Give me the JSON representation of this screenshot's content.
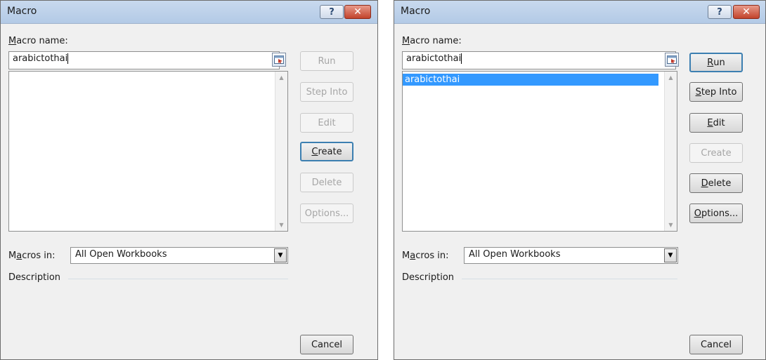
{
  "dialogs": [
    {
      "title": "Macro",
      "help_glyph": "?",
      "close_glyph": "✕",
      "macro_name_label": {
        "prefix": "",
        "accel": "M",
        "suffix": "acro name:"
      },
      "macro_name_value": "arabictothai",
      "macro_list": [],
      "buttons": {
        "run": {
          "prefix": "",
          "accel": "",
          "suffix": "Run",
          "enabled": false
        },
        "step_into": {
          "prefix": "",
          "accel": "",
          "suffix": "Step Into",
          "enabled": false
        },
        "edit": {
          "prefix": "",
          "accel": "",
          "suffix": "Edit",
          "enabled": false
        },
        "create": {
          "prefix": "",
          "accel": "C",
          "suffix": "reate",
          "enabled": true
        },
        "delete": {
          "prefix": "",
          "accel": "",
          "suffix": "Delete",
          "enabled": false
        },
        "options": {
          "prefix": "",
          "accel": "",
          "suffix": "Options...",
          "enabled": false
        },
        "cancel": {
          "prefix": "",
          "accel": "",
          "suffix": "Cancel",
          "enabled": true
        }
      },
      "macros_in_label": {
        "prefix": "M",
        "accel": "a",
        "suffix": "cros in:"
      },
      "macros_in_value": "All Open Workbooks",
      "description_label": "Description"
    },
    {
      "title": "Macro",
      "help_glyph": "?",
      "close_glyph": "✕",
      "macro_name_label": {
        "prefix": "",
        "accel": "M",
        "suffix": "acro name:"
      },
      "macro_name_value": "arabictothai",
      "macro_list": [
        "arabictothai"
      ],
      "buttons": {
        "run": {
          "prefix": "",
          "accel": "R",
          "suffix": "un",
          "enabled": true
        },
        "step_into": {
          "prefix": "",
          "accel": "S",
          "suffix": "tep Into",
          "enabled": true
        },
        "edit": {
          "prefix": "",
          "accel": "E",
          "suffix": "dit",
          "enabled": true
        },
        "create": {
          "prefix": "",
          "accel": "",
          "suffix": "Create",
          "enabled": false
        },
        "delete": {
          "prefix": "",
          "accel": "D",
          "suffix": "elete",
          "enabled": true
        },
        "options": {
          "prefix": "",
          "accel": "O",
          "suffix": "ptions...",
          "enabled": true
        },
        "cancel": {
          "prefix": "",
          "accel": "",
          "suffix": "Cancel",
          "enabled": true
        }
      },
      "macros_in_label": {
        "prefix": "M",
        "accel": "a",
        "suffix": "cros in:"
      },
      "macros_in_value": "All Open Workbooks",
      "description_label": "Description"
    }
  ]
}
